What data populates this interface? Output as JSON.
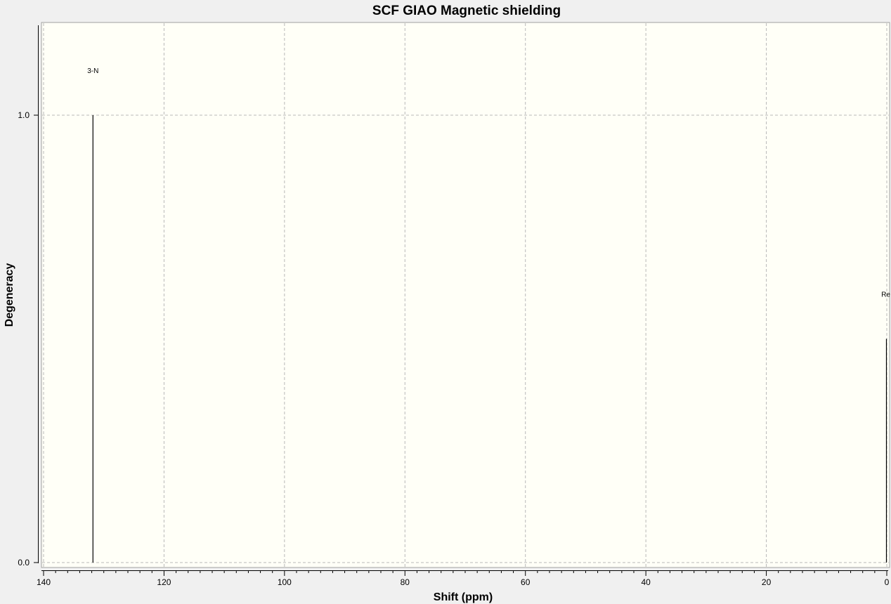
{
  "chart_data": {
    "type": "bar",
    "title": "SCF GIAO Magnetic shielding",
    "xlabel": "Shift (ppm)",
    "ylabel": "Degeneracy",
    "xlim": [
      140,
      0
    ],
    "ylim": [
      0.0,
      1.0
    ],
    "x_ticks": [
      140,
      120,
      100,
      80,
      60,
      40,
      20,
      0
    ],
    "y_ticks": [
      "0.0",
      "1.0"
    ],
    "grid": true,
    "background_color": "#fffff7",
    "bar_color": "#000000",
    "peaks": [
      {
        "label": "3-N",
        "shift": 131.8,
        "degeneracy": 1.0
      },
      {
        "label": "Re",
        "shift": -0.2,
        "degeneracy": 0.5
      }
    ]
  }
}
